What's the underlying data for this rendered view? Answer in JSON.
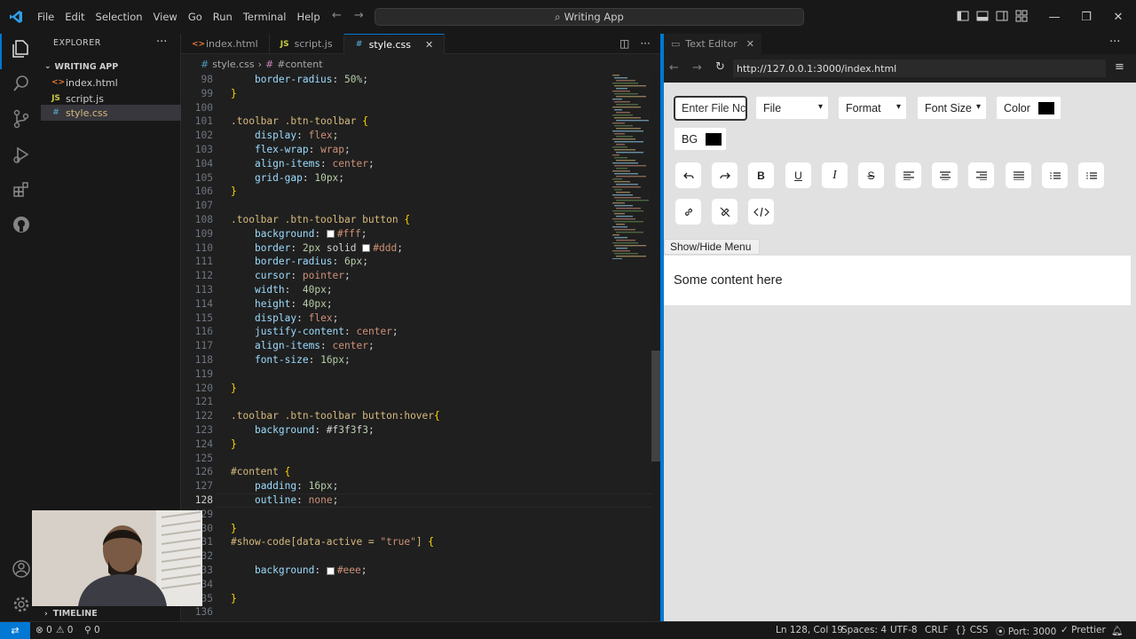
{
  "menu": [
    "File",
    "Edit",
    "Selection",
    "View",
    "Go",
    "Run",
    "Terminal",
    "Help"
  ],
  "command_center": "Writing App",
  "sidebar": {
    "title": "EXPLORER",
    "folder": "WRITING APP",
    "files": [
      {
        "icon": "<>",
        "name": "index.html",
        "color": "#e37933"
      },
      {
        "icon": "JS",
        "name": "script.js",
        "color": "#cbcb41"
      },
      {
        "icon": "#",
        "name": "style.css",
        "color": "#519aba"
      }
    ],
    "timeline": "TIMELINE"
  },
  "tabs": [
    {
      "icon": "<>",
      "label": "index.html",
      "color": "#e37933"
    },
    {
      "icon": "JS",
      "label": "script.js",
      "color": "#cbcb41"
    },
    {
      "icon": "#",
      "label": "style.css",
      "color": "#519aba"
    }
  ],
  "breadcrumb": {
    "file": "style.css",
    "symbol": "#content"
  },
  "code_lines": [
    {
      "n": "98",
      "t": "    border-radius: 50%;"
    },
    {
      "n": "99",
      "t": "}"
    },
    {
      "n": "100",
      "t": ""
    },
    {
      "n": "101",
      "t": ".toolbar .btn-toolbar {"
    },
    {
      "n": "102",
      "t": "    display: flex;"
    },
    {
      "n": "103",
      "t": "    flex-wrap: wrap;"
    },
    {
      "n": "104",
      "t": "    align-items: center;"
    },
    {
      "n": "105",
      "t": "    grid-gap: 10px;"
    },
    {
      "n": "106",
      "t": "}"
    },
    {
      "n": "107",
      "t": ""
    },
    {
      "n": "108",
      "t": ".toolbar .btn-toolbar button {"
    },
    {
      "n": "109",
      "t": "    background: #fff;"
    },
    {
      "n": "110",
      "t": "    border: 2px solid #ddd;"
    },
    {
      "n": "111",
      "t": "    border-radius: 6px;"
    },
    {
      "n": "112",
      "t": "    cursor: pointer;"
    },
    {
      "n": "113",
      "t": "    width:  40px;"
    },
    {
      "n": "114",
      "t": "    height: 40px;"
    },
    {
      "n": "115",
      "t": "    display: flex;"
    },
    {
      "n": "116",
      "t": "    justify-content: center;"
    },
    {
      "n": "117",
      "t": "    align-items: center;"
    },
    {
      "n": "118",
      "t": "    font-size: 16px;"
    },
    {
      "n": "119",
      "t": ""
    },
    {
      "n": "120",
      "t": "}"
    },
    {
      "n": "121",
      "t": ""
    },
    {
      "n": "122",
      "t": ".toolbar .btn-toolbar button:hover{"
    },
    {
      "n": "123",
      "t": "    background: #f3f3f3;"
    },
    {
      "n": "124",
      "t": "}"
    },
    {
      "n": "125",
      "t": ""
    },
    {
      "n": "126",
      "t": "#content {"
    },
    {
      "n": "127",
      "t": "    padding: 16px;"
    },
    {
      "n": "128",
      "t": "    outline: none;"
    },
    {
      "n": "129",
      "t": ""
    },
    {
      "n": "130",
      "t": "}"
    },
    {
      "n": "131",
      "t": "#show-code[data-active = \"true\"] {"
    },
    {
      "n": "132",
      "t": ""
    },
    {
      "n": "133",
      "t": "    background: #eee;"
    },
    {
      "n": "134",
      "t": ""
    },
    {
      "n": "135",
      "t": "}"
    },
    {
      "n": "136",
      "t": ""
    },
    {
      "n": "137",
      "t": "#hide-button {"
    }
  ],
  "current_line": "128",
  "right_panel": {
    "tab": "Text Editor",
    "url": "http://127.0.0.1:3000/index.html",
    "file_placeholder": "Enter File Nc",
    "selects": [
      "File",
      "Format",
      "Font Size"
    ],
    "color_label": "Color",
    "bg_label": "BG",
    "show_hide": "Show/Hide Menu",
    "content": "Some content here"
  },
  "status": {
    "errors": "0",
    "warnings": "0",
    "ports": "0",
    "position": "Ln 128, Col 19",
    "spaces": "Spaces: 4",
    "encoding": "UTF-8",
    "eol": "CRLF",
    "language": "CSS",
    "port": "Port: 3000",
    "prettier": "Prettier"
  }
}
